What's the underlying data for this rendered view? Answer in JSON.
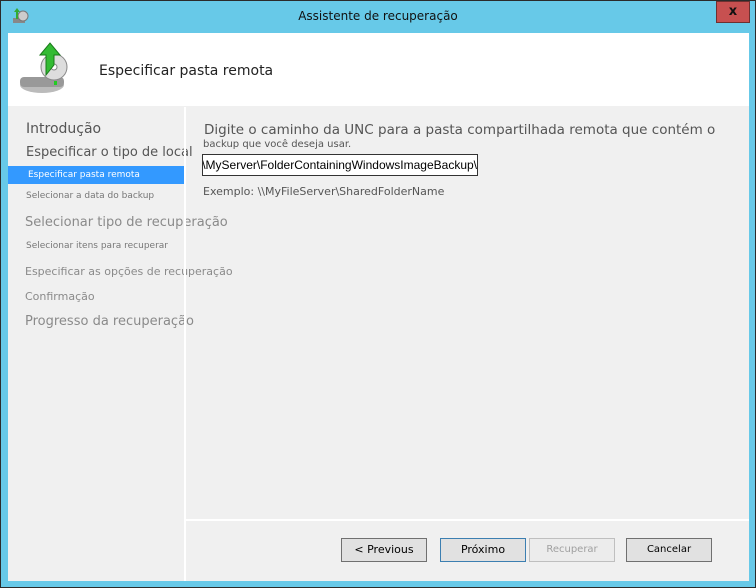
{
  "window": {
    "title": "Assistente de recuperação",
    "close_label": "x"
  },
  "header": {
    "title": "Especificar pasta remota"
  },
  "steps": [
    {
      "label": "Introdução",
      "state": "done"
    },
    {
      "label": "Especificar o tipo de local",
      "state": "done"
    },
    {
      "label": "Especificar pasta remota",
      "state": "active"
    },
    {
      "label": "Selecionar a data do backup",
      "state": "pending"
    },
    {
      "label": "Selecionar tipo de recuperação",
      "state": "pending"
    },
    {
      "label": "Selecionar itens para recuperar",
      "state": "pending"
    },
    {
      "label": "Especificar as opções de recuperação",
      "state": "pending"
    },
    {
      "label": "Confirmação",
      "state": "pending"
    },
    {
      "label": "Progresso da recuperação",
      "state": "pending"
    }
  ],
  "main": {
    "prompt_line1": "Digite o caminho da UNC para a pasta compartilhada remota que contém o",
    "prompt_line2": "backup que você deseja usar.",
    "unc_value": "\\\\MyServer\\FolderContainingWindowsImageBackup\\",
    "example": "Exemplo: \\\\MyFileServer\\SharedFolderName"
  },
  "buttons": {
    "previous": "< Previous",
    "next": "Próximo",
    "recover": "Recuperar",
    "cancel": "Cancelar"
  },
  "colors": {
    "frame": "#67c9e8",
    "active_step": "#3399ff",
    "close": "#c75050"
  }
}
